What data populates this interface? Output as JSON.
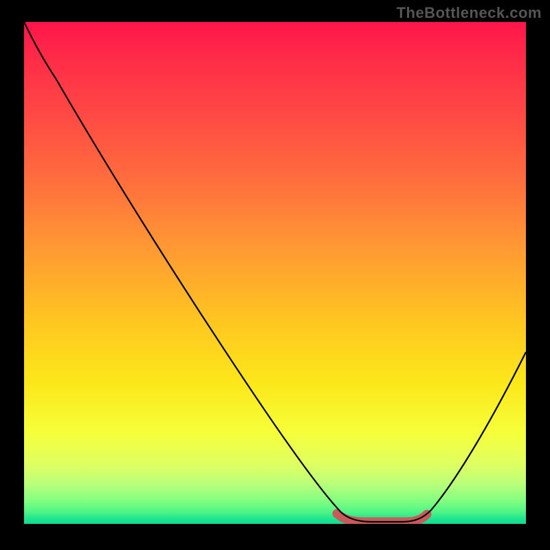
{
  "watermark": "TheBottleneck.com",
  "chart_data": {
    "type": "line",
    "title": "",
    "xlabel": "",
    "ylabel": "",
    "xlim": [
      0.05,
      1.0
    ],
    "ylim": [
      0,
      1.0
    ],
    "notes": "Bottleneck curve: descends from top-left to a flat minimum near x≈0.67–0.78, then rises toward right. Background is a vertical heat gradient (red→green). Highlighted red segment marks the flat near-zero minimum.",
    "series": [
      {
        "name": "bottleneck",
        "x": [
          0.05,
          0.09,
          0.18,
          0.3,
          0.42,
          0.52,
          0.6,
          0.65,
          0.68,
          0.73,
          0.78,
          0.82,
          0.88,
          0.94,
          1.0
        ],
        "values": [
          1.0,
          0.92,
          0.78,
          0.6,
          0.42,
          0.27,
          0.13,
          0.04,
          0.005,
          0.0,
          0.005,
          0.04,
          0.14,
          0.26,
          0.4
        ]
      }
    ],
    "highlight_range_x": [
      0.64,
      0.8
    ],
    "gradient_stops": [
      {
        "pos": 0.0,
        "color": "#ff144b"
      },
      {
        "pos": 0.45,
        "color": "#ff9933"
      },
      {
        "pos": 0.82,
        "color": "#f5ff3a"
      },
      {
        "pos": 1.0,
        "color": "#0cdc92"
      }
    ]
  }
}
